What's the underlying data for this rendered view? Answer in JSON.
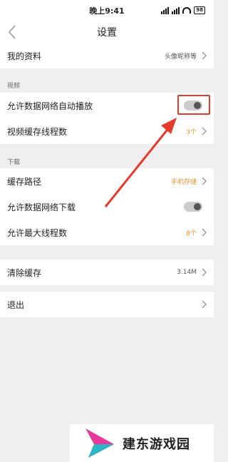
{
  "status": {
    "time": "晚上9:41",
    "battery": "98"
  },
  "nav": {
    "title": "设置"
  },
  "rows": {
    "profile": {
      "label": "我的资料",
      "value": "头像昵称等"
    },
    "video_header": "视频",
    "autoplay": {
      "label": "允许数据网络自动播放",
      "enabled": false
    },
    "video_threads": {
      "label": "视频缓存线程数",
      "value": "3个"
    },
    "download_header": "下载",
    "cache_path": {
      "label": "缓存路径",
      "value": "手机存储"
    },
    "data_download": {
      "label": "允许数据网络下载",
      "enabled": false
    },
    "max_threads": {
      "label": "允许最大线程数",
      "value": "8个"
    },
    "clear_cache": {
      "label": "清除缓存",
      "value": "3.14M"
    },
    "logout": {
      "label": "退出"
    }
  },
  "watermark": {
    "text": "建东游戏园"
  },
  "colors": {
    "accent_orange": "#e8902b",
    "annotation_red": "#e53a2c"
  }
}
